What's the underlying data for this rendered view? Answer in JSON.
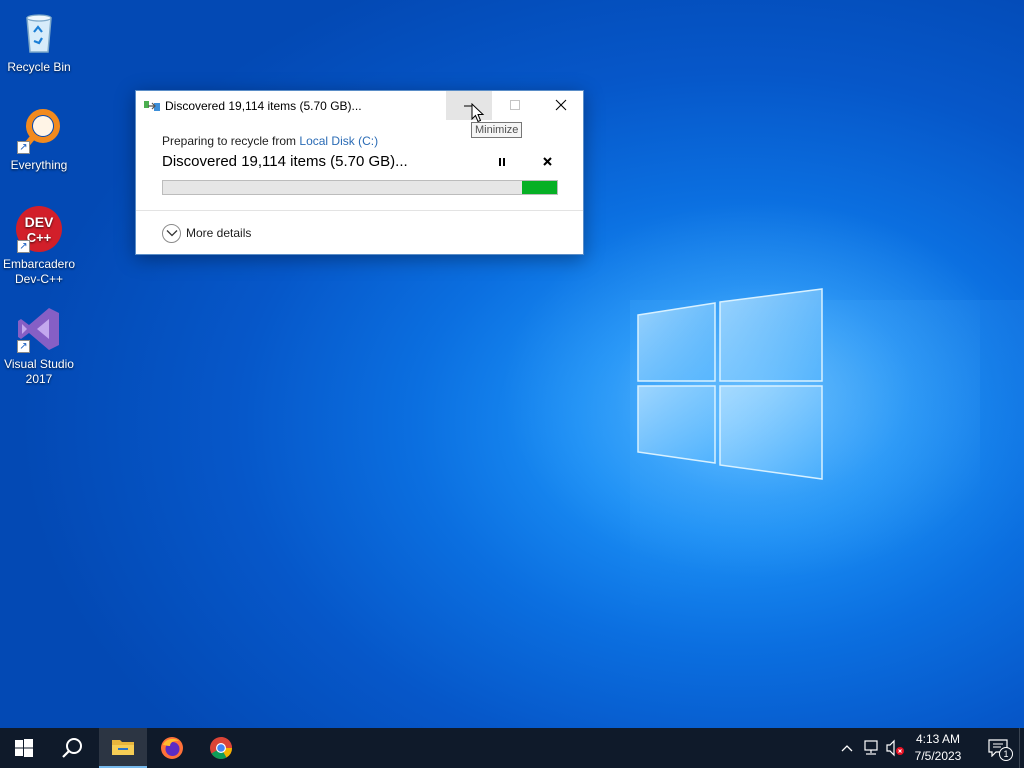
{
  "desktop": {
    "icons": [
      {
        "label": "Recycle Bin",
        "icon": "recycle-bin-icon"
      },
      {
        "label": "Everything",
        "icon": "everything-search-icon"
      },
      {
        "label": "Embarcadero Dev-C++",
        "icon": "devcpp-icon",
        "logo_text": "DEV C++"
      },
      {
        "label": "Visual Studio 2017",
        "icon": "visual-studio-icon"
      }
    ]
  },
  "dialog": {
    "title": "Discovered 19,114 items (5.70 GB)...",
    "tooltip": "Minimize",
    "prep_prefix": "Preparing to recycle from ",
    "prep_link": "Local Disk (C:)",
    "status": "Discovered 19,114 items (5.70 GB)...",
    "more_details": "More details",
    "progress_indeterminate_segment": {
      "start": 0.91,
      "end": 1.0
    },
    "progress_color": "#06b025"
  },
  "taskbar": {
    "start": "windows-start-icon",
    "search": "search-icon",
    "apps": [
      {
        "name": "File Explorer",
        "icon": "file-explorer-icon",
        "active": true
      },
      {
        "name": "Firefox",
        "icon": "firefox-icon",
        "active": false
      },
      {
        "name": "Chrome",
        "icon": "chrome-icon",
        "active": false
      }
    ],
    "tray": {
      "time": "4:13 AM",
      "date": "7/5/2023",
      "notification_count": "1"
    }
  },
  "colors": {
    "accent": "#0b6fe0",
    "taskbar": "#0f1a2a",
    "link": "#2a6bb5"
  }
}
